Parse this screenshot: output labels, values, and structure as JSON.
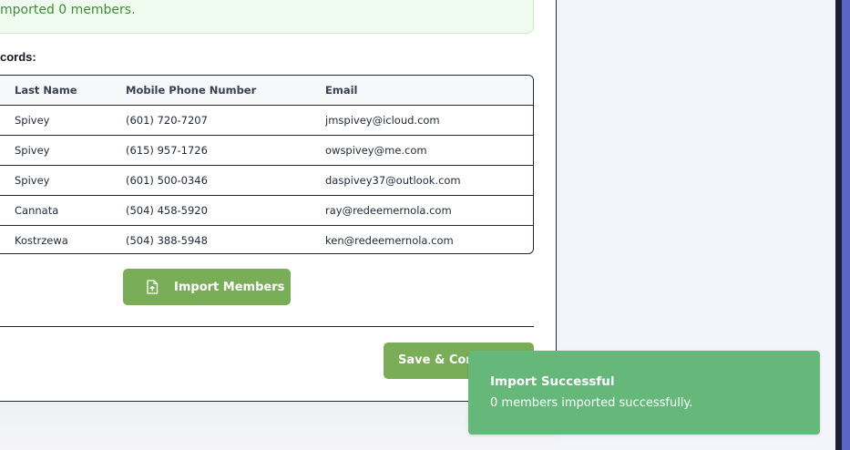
{
  "alert": {
    "text": "mported 0 members."
  },
  "records": {
    "label": "cords:",
    "columns": {
      "last_name": "Last Name",
      "phone": "Mobile Phone Number",
      "email": "Email"
    },
    "rows": [
      {
        "last_name": "Spivey",
        "phone": "(601) 720-7207",
        "email": "jmspivey@icloud.com"
      },
      {
        "last_name": "Spivey",
        "phone": "(615) 957-1726",
        "email": "owspivey@me.com"
      },
      {
        "last_name": "Spivey",
        "phone": "(601) 500-0346",
        "email": "daspivey37@outlook.com"
      },
      {
        "last_name": "Cannata",
        "phone": "(504) 458-5920",
        "email": "ray@redeemernola.com"
      },
      {
        "last_name": "Kostrzewa",
        "phone": "(504) 388-5948",
        "email": "ken@redeemernola.com"
      }
    ]
  },
  "actions": {
    "import_label": "Import Members",
    "import_icon": "file-upload-icon",
    "save_label": "Save & Continue"
  },
  "toast": {
    "title": "Import Successful",
    "message": "0 members imported successfully."
  },
  "colors": {
    "accent_green": "#79ad58",
    "toast_green": "#65b77a",
    "success_text": "#3f8a3a",
    "side_panel_purple": "#5a63c6"
  }
}
